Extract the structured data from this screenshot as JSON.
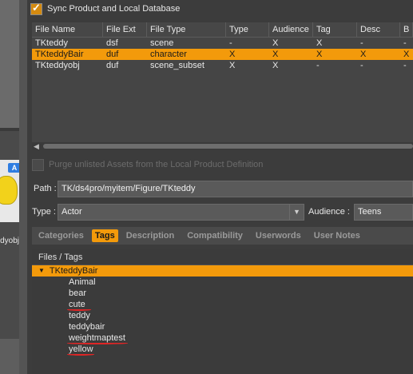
{
  "background_window": {
    "thumb_badge": "A",
    "thumb_label": "dyobj"
  },
  "dialog": {
    "sync_checkbox": {
      "label": "Sync Product and Local Database",
      "checked": true
    },
    "table": {
      "columns": [
        "File Name",
        "File Ext",
        "File Type",
        "Type",
        "Audience",
        "Tag",
        "Desc",
        "B"
      ],
      "rows": [
        {
          "name": "TKteddy",
          "ext": "dsf",
          "filetype": "scene",
          "type": "-",
          "audience": "X",
          "tag": "X",
          "desc": "-",
          "b": "-",
          "selected": false
        },
        {
          "name": "TKteddyBair",
          "ext": "duf",
          "filetype": "character",
          "type": "X",
          "audience": "X",
          "tag": "X",
          "desc": "X",
          "b": "X",
          "selected": true
        },
        {
          "name": "TKteddyobj",
          "ext": "duf",
          "filetype": "scene_subset",
          "type": "X",
          "audience": "X",
          "tag": "-",
          "desc": "-",
          "b": "-",
          "selected": false
        }
      ]
    },
    "purge_checkbox": {
      "label": "Purge unlisted Assets from the Local Product Definition",
      "checked": false
    },
    "path": {
      "label": "Path :",
      "value": "TK/ds4pro/myitem/Figure/TKteddy"
    },
    "type_field": {
      "label": "Type :",
      "value": "Actor"
    },
    "audience_field": {
      "label": "Audience :",
      "value": "Teens"
    },
    "tabs": [
      {
        "label": "Categories",
        "active": false
      },
      {
        "label": "Tags",
        "active": true
      },
      {
        "label": "Description",
        "active": false
      },
      {
        "label": "Compatibility",
        "active": false
      },
      {
        "label": "Userwords",
        "active": false
      },
      {
        "label": "User Notes",
        "active": false
      }
    ],
    "tags_panel": {
      "header": "Files / Tags",
      "root": "TKteddyBair",
      "items": [
        {
          "label": "Animal",
          "underlined": false
        },
        {
          "label": "bear",
          "underlined": false
        },
        {
          "label": "cute",
          "underlined": true
        },
        {
          "label": "teddy",
          "underlined": false
        },
        {
          "label": "teddybair",
          "underlined": false
        },
        {
          "label": "weightmaptest",
          "underlined": true
        },
        {
          "label": "yellow",
          "underlined": true
        }
      ]
    }
  },
  "colors": {
    "accent": "#f39a0b",
    "annotation_red": "#e02525"
  }
}
